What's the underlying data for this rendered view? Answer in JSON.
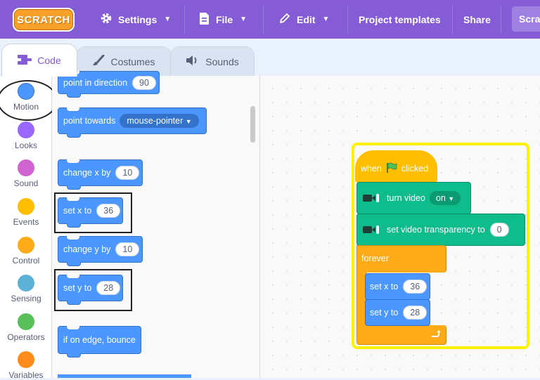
{
  "menubar": {
    "logo": "SCRATCH",
    "settings": "Settings",
    "file": "File",
    "edit": "Edit",
    "project_templates": "Project templates",
    "share": "Share",
    "scratch_button": "Scra"
  },
  "tabs": {
    "code": "Code",
    "costumes": "Costumes",
    "sounds": "Sounds"
  },
  "categories": [
    {
      "label": "Motion",
      "color": "#4c97ff"
    },
    {
      "label": "Looks",
      "color": "#9966ff"
    },
    {
      "label": "Sound",
      "color": "#cf63cf"
    },
    {
      "label": "Events",
      "color": "#ffbf00"
    },
    {
      "label": "Control",
      "color": "#ffab19"
    },
    {
      "label": "Sensing",
      "color": "#5cb1d6"
    },
    {
      "label": "Operators",
      "color": "#59c059"
    },
    {
      "label": "Variables",
      "color": "#ff8c1a"
    }
  ],
  "palette": {
    "point_direction": {
      "label": "point in direction",
      "value": "90"
    },
    "point_towards": {
      "label": "point towards",
      "value": "mouse-pointer"
    },
    "change_x": {
      "label": "change x by",
      "value": "10"
    },
    "set_x": {
      "label": "set x to",
      "value": "36"
    },
    "change_y": {
      "label": "change y by",
      "value": "10"
    },
    "set_y": {
      "label": "set y to",
      "value": "28"
    },
    "bounce": {
      "label": "if on edge, bounce"
    }
  },
  "script": {
    "hat_when": "when",
    "hat_clicked": "clicked",
    "turn_video": {
      "label": "turn video",
      "value": "on"
    },
    "transparency": {
      "label": "set video transparency to",
      "value": "0"
    },
    "forever": "forever",
    "set_x": {
      "label": "set x to",
      "value": "36"
    },
    "set_y": {
      "label": "set y to",
      "value": "28"
    }
  }
}
